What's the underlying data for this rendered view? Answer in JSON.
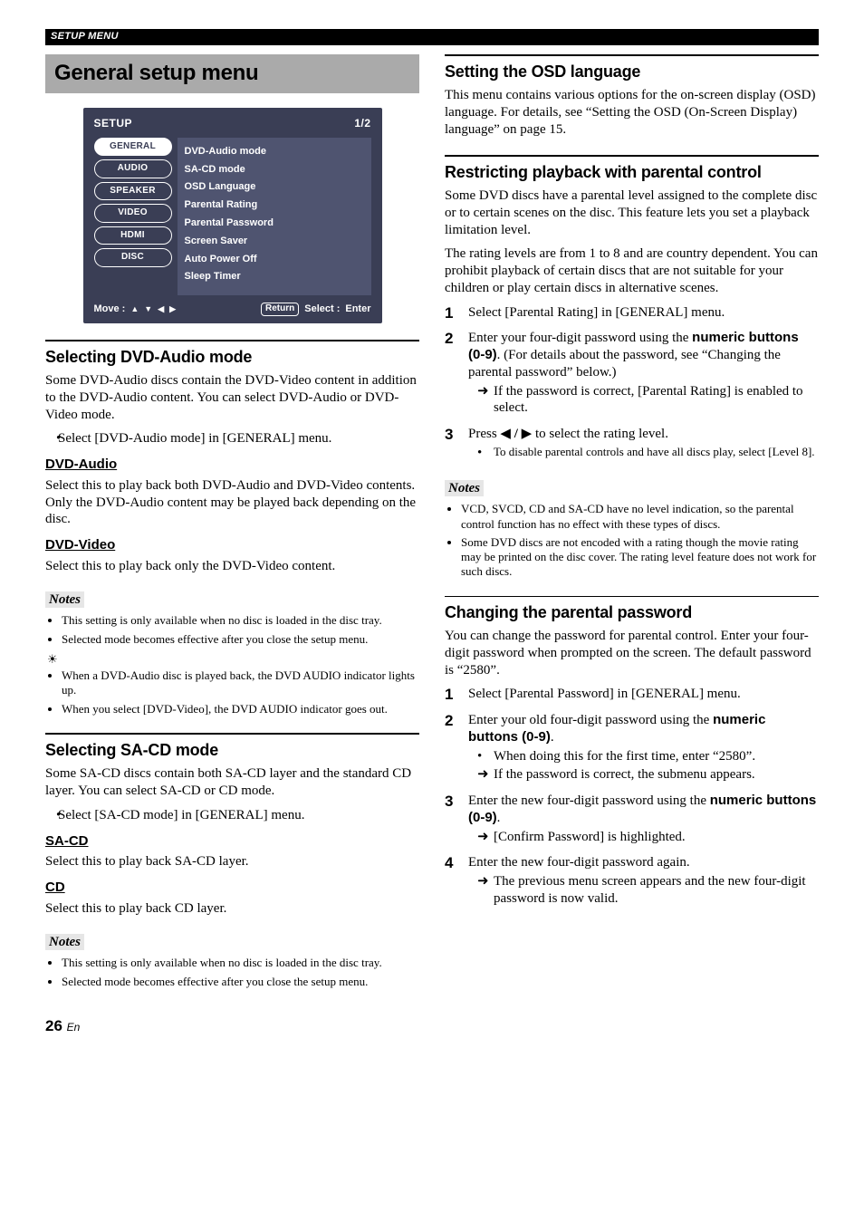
{
  "header_bar": "SETUP MENU",
  "page_title": "General setup menu",
  "osd": {
    "setup_label": "SETUP",
    "page_indicator": "1/2",
    "tabs": [
      "GENERAL",
      "AUDIO",
      "SPEAKER",
      "VIDEO",
      "HDMI",
      "DISC"
    ],
    "items": [
      "DVD-Audio mode",
      "SA-CD mode",
      "OSD Language",
      "Parental Rating",
      "Parental Password",
      "Screen Saver",
      "Auto Power Off",
      "Sleep Timer"
    ],
    "move_label": "Move :",
    "return_label": "Return",
    "select_label": "Select :",
    "enter_label": "Enter"
  },
  "left": {
    "dvdaudio": {
      "heading": "Selecting DVD-Audio mode",
      "intro": "Some DVD-Audio discs contain the DVD-Video content in addition to the DVD-Audio content. You can select DVD-Audio or DVD-Video mode.",
      "bullet": "Select [DVD-Audio mode] in [GENERAL] menu.",
      "opt1_label": "DVD-Audio",
      "opt1_text": "Select this to play back both DVD-Audio and DVD-Video contents. Only the DVD-Audio content may be played back depending on the disc.",
      "opt2_label": "DVD-Video",
      "opt2_text": "Select this to play back only the DVD-Video content.",
      "notes": [
        "This setting is only available when no disc is loaded in the disc tray.",
        "Selected mode becomes effective after you close the setup menu."
      ],
      "hints": [
        "When a DVD-Audio disc is played back, the DVD AUDIO indicator lights up.",
        "When you select [DVD-Video], the DVD AUDIO indicator goes out."
      ]
    },
    "sacd": {
      "heading": "Selecting SA-CD mode",
      "intro": "Some SA-CD discs contain both SA-CD layer and the standard CD layer. You can select SA-CD or CD mode.",
      "bullet": "Select [SA-CD mode] in [GENERAL] menu.",
      "opt1_label": "SA-CD",
      "opt1_text": "Select this to play back SA-CD layer.",
      "opt2_label": "CD",
      "opt2_text": "Select this to play back CD layer.",
      "notes": [
        "This setting is only available when no disc is loaded in the disc tray.",
        "Selected mode becomes effective after you close the setup menu."
      ]
    }
  },
  "right": {
    "osdlang": {
      "heading": "Setting the OSD language",
      "text": "This menu contains various options for the on-screen display (OSD) language. For details, see “Setting the OSD (On-Screen Display) language” on page 15."
    },
    "parental": {
      "heading": "Restricting playback with parental control",
      "p1": "Some DVD discs have a parental level assigned to the complete disc or to certain scenes on the disc. This feature lets you set a playback limitation level.",
      "p2": "The rating levels are from 1 to 8 and are country dependent. You can prohibit playback of certain discs that are not suitable for your children or play certain discs in alternative scenes.",
      "steps": {
        "s1": "Select [Parental Rating] in [GENERAL] menu.",
        "s2_pre": "Enter your four-digit password using the ",
        "s2_bold": "numeric buttons (0-9)",
        "s2_post": ". (For details about the password, see “Changing the parental password” below.)",
        "s2_arrow": "If the password is correct, [Parental Rating] is enabled to select.",
        "s3_pre": "Press ",
        "s3_post": " to select the rating level.",
        "s3_sub": "To disable parental controls and have all discs play, select [Level 8]."
      },
      "notes": [
        "VCD, SVCD, CD and SA-CD have no level indication, so the parental control function has no effect with these types of discs.",
        "Some DVD discs are not encoded with a rating though the movie rating may be printed on the disc cover. The rating level feature does not work for such discs."
      ]
    },
    "pwd": {
      "heading": "Changing the parental password",
      "intro": "You can change the password for parental control. Enter your four-digit password when prompted on the screen. The default password is “2580”.",
      "s1": "Select [Parental Password] in [GENERAL] menu.",
      "s2_pre": "Enter your old four-digit password using the ",
      "s2_bold": "numeric buttons (0-9)",
      "s2_post": ".",
      "s2_sub": "When doing this for the first time, enter “2580”.",
      "s2_arrow": "If the password is correct, the submenu appears.",
      "s3_pre": "Enter the new four-digit password using the ",
      "s3_bold": "numeric buttons (0-9)",
      "s3_post": ".",
      "s3_arrow": "[Confirm Password] is highlighted.",
      "s4": "Enter the new four-digit password again.",
      "s4_arrow": "The previous menu screen appears and the new four-digit password is now valid."
    }
  },
  "notes_label": "Notes",
  "page_number": "26",
  "page_lang": "En"
}
